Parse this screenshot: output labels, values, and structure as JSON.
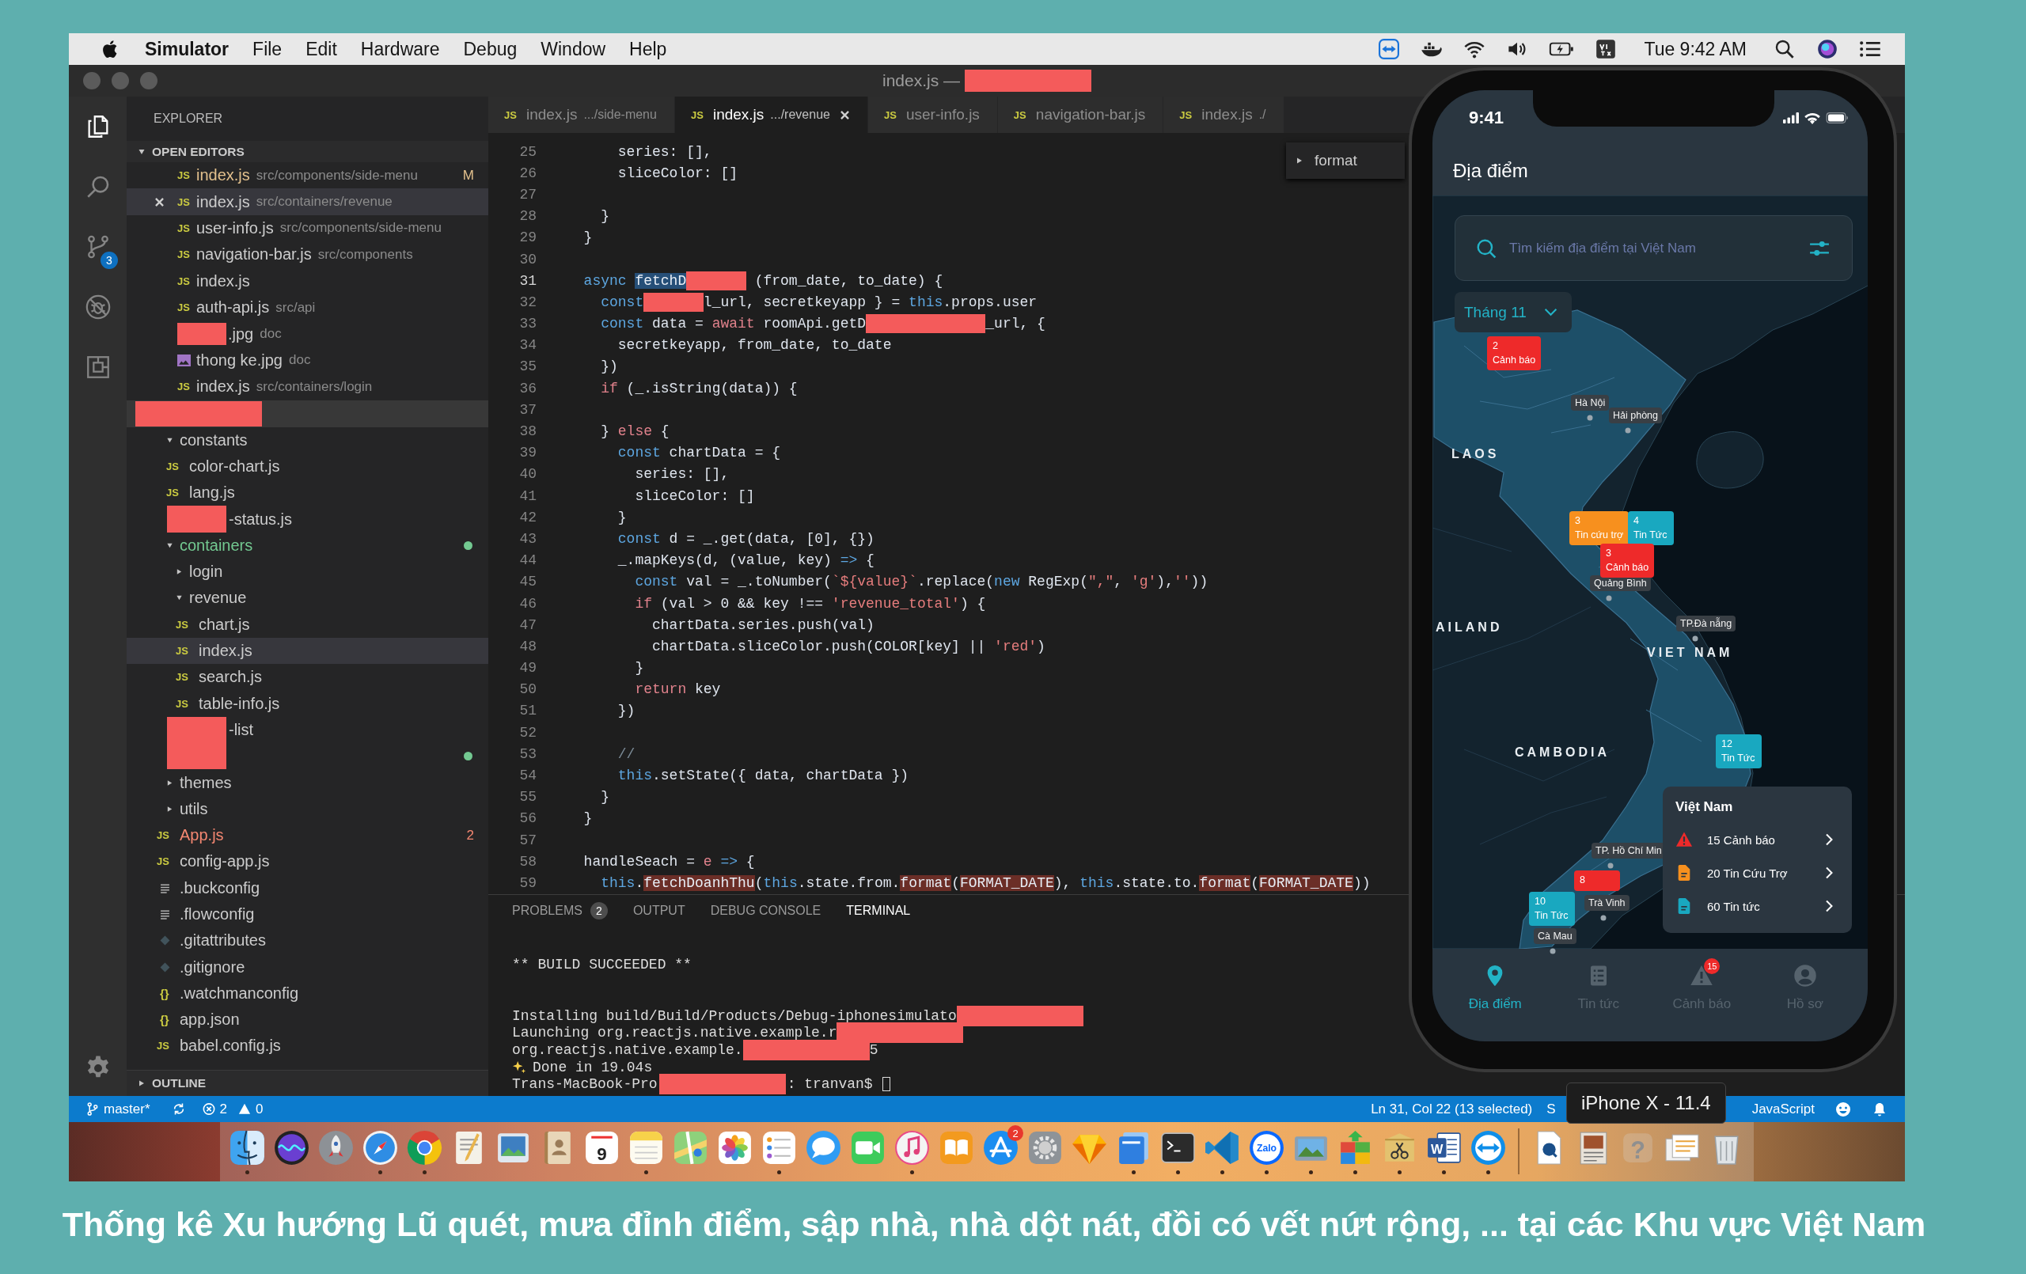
{
  "menu_bar": {
    "app_name": "Simulator",
    "menus": [
      "File",
      "Edit",
      "Hardware",
      "Debug",
      "Window",
      "Help"
    ],
    "clock": "Tue 9:42 AM"
  },
  "window": {
    "title": "index.js —"
  },
  "activity_bar": {
    "items": [
      {
        "kind": "explorer",
        "selected": true
      },
      {
        "kind": "search",
        "selected": false
      },
      {
        "kind": "source_control",
        "selected": false,
        "badge": "3"
      },
      {
        "kind": "debug",
        "selected": false
      },
      {
        "kind": "extensions",
        "selected": false
      }
    ]
  },
  "explorer": {
    "title": "EXPLORER",
    "open_editors": {
      "label": "OPEN EDITORS",
      "expanded": true,
      "items": [
        {
          "kind": "js",
          "icon_label": "JS",
          "name": "index.js",
          "path": "src/components/side-menu",
          "color": "#e2c08d",
          "badge": "M",
          "selected": false
        },
        {
          "kind": "js",
          "icon_label": "JS",
          "name": "index.js",
          "path": "src/containers/revenue",
          "selected": true
        },
        {
          "kind": "js",
          "icon_label": "JS",
          "name": "user-info.js",
          "path": "src/components/side-menu",
          "selected": false
        },
        {
          "kind": "js",
          "icon_label": "JS",
          "name": "navigation-bar.js",
          "path": "src/components",
          "selected": false
        },
        {
          "kind": "js",
          "icon_label": "JS",
          "name": "index.js",
          "selected": false
        },
        {
          "kind": "js",
          "icon_label": "JS",
          "name": "auth-api.js",
          "path": "src/api",
          "selected": false
        },
        {
          "kind": "redacted",
          "name": ".jpg",
          "path": "doc",
          "selected": false
        },
        {
          "kind": "image",
          "name": "thong ke.jpg",
          "path": "doc",
          "selected": false
        },
        {
          "kind": "js",
          "icon_label": "JS",
          "name": "index.js",
          "path": "src/containers/login",
          "selected": false
        }
      ]
    },
    "tree": [
      {
        "kind": "folder",
        "name": "constants",
        "expanded": true,
        "selected": false,
        "children": [
          {
            "kind": "js",
            "icon_label": "JS",
            "name": "color-chart.js",
            "selected": false
          },
          {
            "kind": "js",
            "icon_label": "JS",
            "name": "lang.js",
            "selected": false
          },
          {
            "kind": "redacted",
            "name": "-status.js",
            "selected": false
          }
        ]
      },
      {
        "kind": "folder",
        "name": "containers",
        "expanded": true,
        "color": "#73c991",
        "selected": false,
        "children": [
          {
            "kind": "folder",
            "name": "login",
            "expanded": false,
            "selected": false
          },
          {
            "kind": "folder",
            "name": "revenue",
            "expanded": true,
            "selected": false,
            "children": [
              {
                "kind": "js",
                "icon_label": "JS",
                "name": "chart.js",
                "selected": false
              },
              {
                "kind": "js",
                "icon_label": "JS",
                "name": "index.js",
                "selected": true
              },
              {
                "kind": "js",
                "icon_label": "JS",
                "name": "search.js",
                "selected": false
              },
              {
                "kind": "js",
                "icon_label": "JS",
                "name": "table-info.js",
                "selected": false
              }
            ]
          },
          {
            "kind": "redacted",
            "name": "-list",
            "selected": false
          },
          {
            "kind": "hidden",
            "color": "#73c991",
            "selected": false
          }
        ]
      },
      {
        "kind": "folder",
        "name": "themes",
        "expanded": false,
        "selected": false
      },
      {
        "kind": "folder",
        "name": "utils",
        "expanded": false,
        "selected": false
      },
      {
        "kind": "js",
        "icon_label": "JS",
        "name": "App.js",
        "color": "#f48771",
        "badge": "2",
        "selected": false
      },
      {
        "kind": "js",
        "icon_label": "JS",
        "name": "config-app.js",
        "selected": false
      },
      {
        "kind": "lines",
        "name": ".buckconfig",
        "selected": false
      },
      {
        "kind": "lines",
        "name": ".flowconfig",
        "selected": false
      },
      {
        "kind": "git",
        "name": ".gitattributes",
        "selected": false
      },
      {
        "kind": "git",
        "name": ".gitignore",
        "selected": false
      },
      {
        "kind": "braces",
        "icon_label": "{}",
        "name": ".watchmanconfig",
        "selected": false
      },
      {
        "kind": "braces",
        "icon_label": "{}",
        "name": "app.json",
        "selected": false
      },
      {
        "kind": "js",
        "icon_label": "JS",
        "name": "babel.config.js",
        "selected": false
      }
    ],
    "outline": {
      "label": "OUTLINE",
      "expanded": false
    }
  },
  "editor_tabs": [
    {
      "icon_label": "JS",
      "name": "index.js",
      "path": ".../side-menu",
      "selected": false
    },
    {
      "icon_label": "JS",
      "name": "index.js",
      "path": ".../revenue",
      "selected": true
    },
    {
      "icon_label": "JS",
      "name": "user-info.js",
      "selected": false
    },
    {
      "icon_label": "JS",
      "name": "navigation-bar.js",
      "selected": false
    },
    {
      "icon_label": "JS",
      "name": "index.js",
      "path": "./",
      "selected": false
    }
  ],
  "outline_popup": {
    "label": "format"
  },
  "code": {
    "lines": [
      {
        "number": "25",
        "current": false,
        "tokens": [
          {
            "kind": "plain",
            "text": "      series: [],"
          }
        ]
      },
      {
        "number": "26",
        "current": false,
        "tokens": [
          {
            "kind": "plain",
            "text": "      sliceColor: []"
          }
        ]
      },
      {
        "number": "27",
        "current": false
      },
      {
        "number": "28",
        "current": false,
        "tokens": [
          {
            "kind": "plain",
            "text": "    }"
          }
        ]
      },
      {
        "number": "29",
        "current": false,
        "tokens": [
          {
            "kind": "plain",
            "text": "  }"
          }
        ]
      },
      {
        "number": "30",
        "current": false
      },
      {
        "number": "31",
        "current": true,
        "tokens": [
          {
            "kind": "keyword",
            "text": "  async "
          },
          {
            "kind": "selection",
            "text": "fetchD"
          },
          {
            "kind": "redacted"
          },
          {
            "kind": "plain",
            "text": " (from_date, to_date) {"
          }
        ]
      },
      {
        "number": "32",
        "current": false,
        "tokens": [
          {
            "kind": "keyword",
            "text": "    const"
          },
          {
            "kind": "redacted"
          },
          {
            "kind": "plain",
            "text": "l_url, secretkeyapp } = "
          },
          {
            "kind": "keyword",
            "text": "this"
          },
          {
            "kind": "plain",
            "text": ".props.user"
          }
        ]
      },
      {
        "number": "33",
        "current": false,
        "tokens": [
          {
            "kind": "keyword",
            "text": "    const"
          },
          {
            "kind": "plain",
            "text": " data = "
          },
          {
            "kind": "control",
            "text": "await"
          },
          {
            "kind": "plain",
            "text": " roomApi.getD"
          },
          {
            "kind": "redacted"
          },
          {
            "kind": "redacted"
          },
          {
            "kind": "plain",
            "text": "_url, {"
          }
        ]
      },
      {
        "number": "34",
        "current": false,
        "tokens": [
          {
            "kind": "plain",
            "text": "      secretkeyapp, from_date, to_date"
          }
        ]
      },
      {
        "number": "35",
        "current": false,
        "tokens": [
          {
            "kind": "plain",
            "text": "    })"
          }
        ]
      },
      {
        "number": "36",
        "current": false,
        "tokens": [
          {
            "kind": "control",
            "text": "    if"
          },
          {
            "kind": "plain",
            "text": " (_.isString(data)) {"
          }
        ]
      },
      {
        "number": "37",
        "current": false
      },
      {
        "number": "38",
        "current": false,
        "tokens": [
          {
            "kind": "plain",
            "text": "    } "
          },
          {
            "kind": "control",
            "text": "else"
          },
          {
            "kind": "plain",
            "text": " {"
          }
        ]
      },
      {
        "number": "39",
        "current": false,
        "tokens": [
          {
            "kind": "keyword",
            "text": "      const"
          },
          {
            "kind": "plain",
            "text": " chartData = {"
          }
        ]
      },
      {
        "number": "40",
        "current": false,
        "tokens": [
          {
            "kind": "plain",
            "text": "        series: [],"
          }
        ]
      },
      {
        "number": "41",
        "current": false,
        "tokens": [
          {
            "kind": "plain",
            "text": "        sliceColor: []"
          }
        ]
      },
      {
        "number": "42",
        "current": false,
        "tokens": [
          {
            "kind": "plain",
            "text": "      }"
          }
        ]
      },
      {
        "number": "43",
        "current": false,
        "tokens": [
          {
            "kind": "keyword",
            "text": "      const"
          },
          {
            "kind": "plain",
            "text": " d = _.get(data, [0], {})"
          }
        ]
      },
      {
        "number": "44",
        "current": false,
        "tokens": [
          {
            "kind": "plain",
            "text": "      _.mapKeys(d, (value, key) "
          },
          {
            "kind": "keyword",
            "text": "=>"
          },
          {
            "kind": "plain",
            "text": " {"
          }
        ]
      },
      {
        "number": "45",
        "current": false,
        "tokens": [
          {
            "kind": "keyword",
            "text": "        const"
          },
          {
            "kind": "plain",
            "text": " val = _.toNumber("
          },
          {
            "kind": "string",
            "text": "`${value}`"
          },
          {
            "kind": "plain",
            "text": ".replace("
          },
          {
            "kind": "keyword",
            "text": "new"
          },
          {
            "kind": "plain",
            "text": " RegExp("
          },
          {
            "kind": "string",
            "text": "\",\""
          },
          {
            "kind": "plain",
            "text": ", "
          },
          {
            "kind": "string",
            "text": "'g'"
          },
          {
            "kind": "plain",
            "text": "),"
          },
          {
            "kind": "string",
            "text": "''"
          },
          {
            "kind": "plain",
            "text": "))"
          }
        ]
      },
      {
        "number": "46",
        "current": false,
        "tokens": [
          {
            "kind": "control",
            "text": "        if"
          },
          {
            "kind": "plain",
            "text": " (val > 0 && key !== "
          },
          {
            "kind": "string",
            "text": "'revenue_total'"
          },
          {
            "kind": "plain",
            "text": ") {"
          }
        ]
      },
      {
        "number": "47",
        "current": false,
        "tokens": [
          {
            "kind": "plain",
            "text": "          chartData.series.push(val)"
          }
        ]
      },
      {
        "number": "48",
        "current": false,
        "tokens": [
          {
            "kind": "plain",
            "text": "          chartData.sliceColor.push(COLOR[key] || "
          },
          {
            "kind": "string",
            "text": "'red'"
          },
          {
            "kind": "plain",
            "text": ")"
          }
        ]
      },
      {
        "number": "49",
        "current": false,
        "tokens": [
          {
            "kind": "plain",
            "text": "        }"
          }
        ]
      },
      {
        "number": "50",
        "current": false,
        "tokens": [
          {
            "kind": "control",
            "text": "        return"
          },
          {
            "kind": "plain",
            "text": " key"
          }
        ]
      },
      {
        "number": "51",
        "current": false,
        "tokens": [
          {
            "kind": "plain",
            "text": "      })"
          }
        ]
      },
      {
        "number": "52",
        "current": false
      },
      {
        "number": "53",
        "current": false,
        "tokens": [
          {
            "kind": "comment",
            "text": "      //"
          }
        ]
      },
      {
        "number": "54",
        "current": false,
        "tokens": [
          {
            "kind": "keyword",
            "text": "      this"
          },
          {
            "kind": "plain",
            "text": ".setState({ data, chartData })"
          }
        ]
      },
      {
        "number": "55",
        "current": false,
        "tokens": [
          {
            "kind": "plain",
            "text": "    }"
          }
        ]
      },
      {
        "number": "56",
        "current": false,
        "tokens": [
          {
            "kind": "plain",
            "text": "  }"
          }
        ]
      },
      {
        "number": "57",
        "current": false
      },
      {
        "number": "58",
        "current": false,
        "tokens": [
          {
            "kind": "plain",
            "text": "  handleSeach = "
          },
          {
            "kind": "control",
            "text": "e"
          },
          {
            "kind": "keyword",
            "text": " =>"
          },
          {
            "kind": "plain",
            "text": " {"
          }
        ]
      },
      {
        "number": "59",
        "current": false,
        "tokens": [
          {
            "kind": "keyword",
            "text": "    this"
          },
          {
            "kind": "plain",
            "text": "."
          },
          {
            "kind": "match",
            "text": "fetchDoanhThu"
          },
          {
            "kind": "plain",
            "text": "("
          },
          {
            "kind": "keyword",
            "text": "this"
          },
          {
            "kind": "plain",
            "text": ".state.from."
          },
          {
            "kind": "match",
            "text": "format"
          },
          {
            "kind": "plain",
            "text": "("
          },
          {
            "kind": "match",
            "text": "FORMAT_DATE"
          },
          {
            "kind": "plain",
            "text": "), "
          },
          {
            "kind": "keyword",
            "text": "this"
          },
          {
            "kind": "plain",
            "text": ".state.to."
          },
          {
            "kind": "match",
            "text": "format"
          },
          {
            "kind": "plain",
            "text": "("
          },
          {
            "kind": "match",
            "text": "FORMAT_DATE"
          },
          {
            "kind": "plain",
            "text": "))"
          }
        ]
      }
    ]
  },
  "panel": {
    "tabs": [
      {
        "label": "PROBLEMS",
        "badge": "2",
        "selected": false
      },
      {
        "label": "OUTPUT",
        "selected": false
      },
      {
        "label": "DEBUG CONSOLE",
        "selected": false
      },
      {
        "label": "TERMINAL",
        "selected": true
      }
    ],
    "terminal": [
      {
        "kind": "banner",
        "segments": [
          {
            "kind": "text",
            "text": "** BUILD SUCCEEDED **"
          }
        ]
      },
      {
        "kind": "output",
        "segments": [
          {
            "kind": "text",
            "text": "Installing build/Build/Products/Debug-iphonesimulato"
          },
          {
            "kind": "redacted"
          }
        ]
      },
      {
        "kind": "output",
        "segments": [
          {
            "kind": "text",
            "text": "Launching org.reactjs.native.example.r"
          },
          {
            "kind": "redacted"
          }
        ]
      },
      {
        "kind": "output",
        "segments": [
          {
            "kind": "text",
            "text": "org.reactjs.native.example."
          },
          {
            "kind": "redacted"
          },
          {
            "kind": "text",
            "text": "5"
          }
        ]
      },
      {
        "kind": "output",
        "segments": [
          {
            "kind": "sparkle"
          },
          {
            "kind": "text",
            "text": "Done in 19.04s"
          }
        ]
      },
      {
        "kind": "prompt",
        "segments": [
          {
            "kind": "text",
            "text": "Trans-MacBook-Pro"
          },
          {
            "kind": "redacted"
          },
          {
            "kind": "text",
            "text": ": tranvan$"
          },
          {
            "kind": "cursor"
          }
        ]
      }
    ]
  },
  "status_bar": {
    "branch": "master*",
    "errors": "2",
    "warnings": "0",
    "cursor": "Ln 31, Col 22 (13 selected)",
    "indent": "S",
    "language": "JavaScript"
  },
  "simulator_tooltip": {
    "text": "iPhone X - 11.4"
  },
  "phone": {
    "time": "9:41",
    "title": "Địa điểm",
    "search": {
      "placeholder": "Tìm kiếm địa điểm tại Việt Nam"
    },
    "month": {
      "value": "Tháng 11"
    },
    "country_labels": [
      "LAOS",
      "AILAND",
      "VIET NAM",
      "CAMBODIA"
    ],
    "city_labels": [
      "Hà Nội",
      "Hải phòng",
      "Quảng Bình",
      "TP.Đà nẵng",
      "TP. Hồ Chí Min",
      "Trà Vinh",
      "Cà Mau"
    ],
    "markers": [
      {
        "count": "2",
        "label": "Cảnh báo",
        "color": "#ee2a2a"
      },
      {
        "count": "3",
        "label": "Tin cứu trợ",
        "color": "#f7901e"
      },
      {
        "count": "4",
        "label": "Tin Tức",
        "color": "#19a8c0"
      },
      {
        "count": "3",
        "label": "Cảnh báo",
        "color": "#ee2a2a"
      },
      {
        "count": "12",
        "label": "Tin Tức",
        "color": "#19a8c0"
      },
      {
        "count": "8",
        "color": "#ee2a2a"
      },
      {
        "count": "10",
        "label": "Tin Tức",
        "color": "#19a8c0"
      }
    ],
    "summary": {
      "title": "Việt Nam",
      "rows": [
        {
          "kind": "alert",
          "text": "15 Cảnh báo"
        },
        {
          "kind": "relief",
          "text": "20 Tin Cứu Trợ"
        },
        {
          "kind": "news",
          "text": "60 Tin tức"
        }
      ]
    },
    "tabs": [
      {
        "kind": "places",
        "label": "Địa điểm",
        "selected": true
      },
      {
        "kind": "news",
        "label": "Tin tức",
        "selected": false
      },
      {
        "kind": "alerts",
        "label": "Cảnh báo",
        "badge": "15",
        "selected": false
      },
      {
        "kind": "profile",
        "label": "Hồ sơ",
        "selected": false
      }
    ]
  },
  "dock": {
    "items": [
      {
        "kind": "face",
        "running": true
      },
      {
        "kind": "orb",
        "running": false
      },
      {
        "kind": "rocket",
        "running": false
      },
      {
        "kind": "compass",
        "running": true
      },
      {
        "kind": "color_wheel",
        "running": true
      },
      {
        "kind": "pencil_paper",
        "running": false
      },
      {
        "kind": "photo_frame",
        "running": false
      },
      {
        "kind": "contact_book",
        "running": false
      },
      {
        "kind": "calendar",
        "date": "9",
        "running": false
      },
      {
        "kind": "notepad",
        "running": true
      },
      {
        "kind": "map",
        "running": false
      },
      {
        "kind": "flower",
        "running": false
      },
      {
        "kind": "checklist",
        "running": true
      },
      {
        "kind": "chat_bubble",
        "running": false
      },
      {
        "kind": "video_camera",
        "running": false
      },
      {
        "kind": "music_note",
        "running": true
      },
      {
        "kind": "open_book",
        "running": false
      },
      {
        "kind": "pencil_cross",
        "badge": "2",
        "running": false
      },
      {
        "kind": "gear",
        "running": false
      },
      {
        "kind": "diamond",
        "running": false
      },
      {
        "kind": "stacked_windows",
        "running": true
      },
      {
        "kind": "terminal",
        "running": true
      },
      {
        "kind": "ribbon",
        "running": true
      },
      {
        "kind": "round_logo",
        "label": "Zalo",
        "running": true
      },
      {
        "kind": "landscape_photo",
        "running": true
      },
      {
        "kind": "tile_grid",
        "running": true
      },
      {
        "kind": "scissors_box",
        "running": true
      },
      {
        "kind": "letter_document",
        "label": "W",
        "running": true
      },
      {
        "kind": "double_arrow",
        "running": true
      },
      {
        "kind": "separator"
      },
      {
        "kind": "document",
        "running": false
      },
      {
        "kind": "photo_document",
        "running": false
      },
      {
        "kind": "question_mark",
        "label": "?",
        "running": false
      },
      {
        "kind": "stacked_papers",
        "running": false
      },
      {
        "kind": "trash",
        "running": false
      }
    ]
  },
  "caption": "Thống kê Xu hướng Lũ quét, mưa đỉnh điểm, sập nhà, nhà dột nát, đồi có vết nứt rộng, ... tại các Khu vực Việt Nam"
}
